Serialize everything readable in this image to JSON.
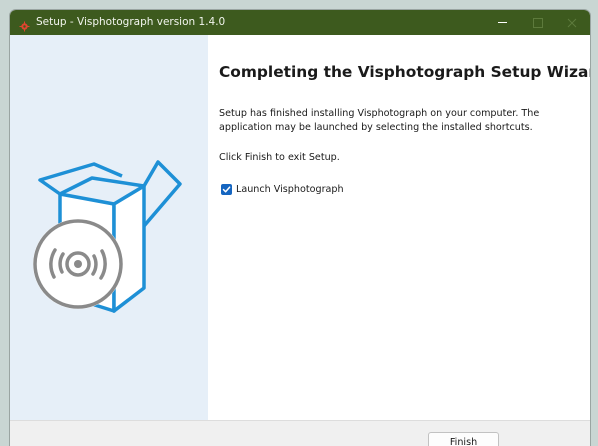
{
  "window": {
    "title": "Setup - Visphotograph version 1.4.0",
    "app_icon": "installer-icon"
  },
  "main": {
    "heading": "Completing the Visphotograph Setup Wizard",
    "paragraph1": "Setup has finished installing Visphotograph on your computer. The application may be launched by selecting the installed shortcuts.",
    "paragraph2": "Click Finish to exit Setup.",
    "launch_checkbox": {
      "label": "Launch Visphotograph",
      "checked": true
    }
  },
  "footer": {
    "finish_label": "Finish"
  },
  "icons": [
    "installer-icon",
    "minimize-icon",
    "maximize-icon",
    "close-icon",
    "software-box-icon",
    "disc-icon",
    "checkmark-icon"
  ],
  "colors": {
    "titlebar": "#3d5a1e",
    "side_panel": "#e6eff8",
    "accent_blue": "#1e90d6",
    "checkbox_blue": "#1565c0"
  }
}
